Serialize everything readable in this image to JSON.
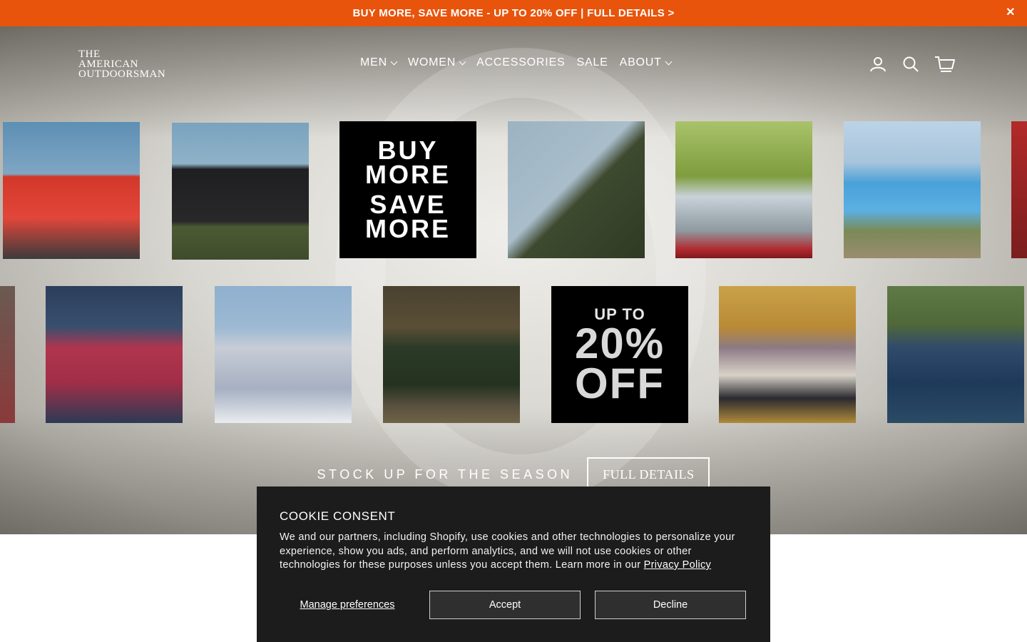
{
  "announcement": {
    "text": "BUY MORE, SAVE MORE - UP TO 20% OFF | FULL DETAILS >",
    "close_icon": "close-icon"
  },
  "brand": {
    "logo_lines": [
      "THE",
      "AMERICAN",
      "OUTDOORSMAN"
    ]
  },
  "nav": {
    "items": [
      {
        "label": "MEN",
        "has_dropdown": true
      },
      {
        "label": "WOMEN",
        "has_dropdown": true
      },
      {
        "label": "ACCESSORIES",
        "has_dropdown": false
      },
      {
        "label": "SALE",
        "has_dropdown": false
      },
      {
        "label": "ABOUT",
        "has_dropdown": true
      }
    ],
    "icons": [
      "account-icon",
      "search-icon",
      "cart-icon"
    ]
  },
  "hero": {
    "promo_tile_1": {
      "lines": [
        "BUY",
        "MORE",
        "SAVE",
        "MORE"
      ]
    },
    "promo_tile_2": {
      "small": "UP TO",
      "big_1": "20%",
      "big_2": "OFF"
    },
    "tagline": "STOCK UP FOR THE SEASON",
    "cta_label": "FULL DETAILS"
  },
  "cookie": {
    "title": "COOKIE CONSENT",
    "body": "We and our partners, including Shopify, use cookies and other technologies to personalize your experience, show you ads, and perform analytics, and we will not use cookies or other technologies for these purposes unless you accept them. Learn more in our ",
    "link": "Privacy Policy",
    "manage_label": "Manage preferences",
    "accept_label": "Accept",
    "decline_label": "Decline"
  },
  "colors": {
    "accent": "#e8540b",
    "cookie_bg": "#1c1c1c"
  }
}
